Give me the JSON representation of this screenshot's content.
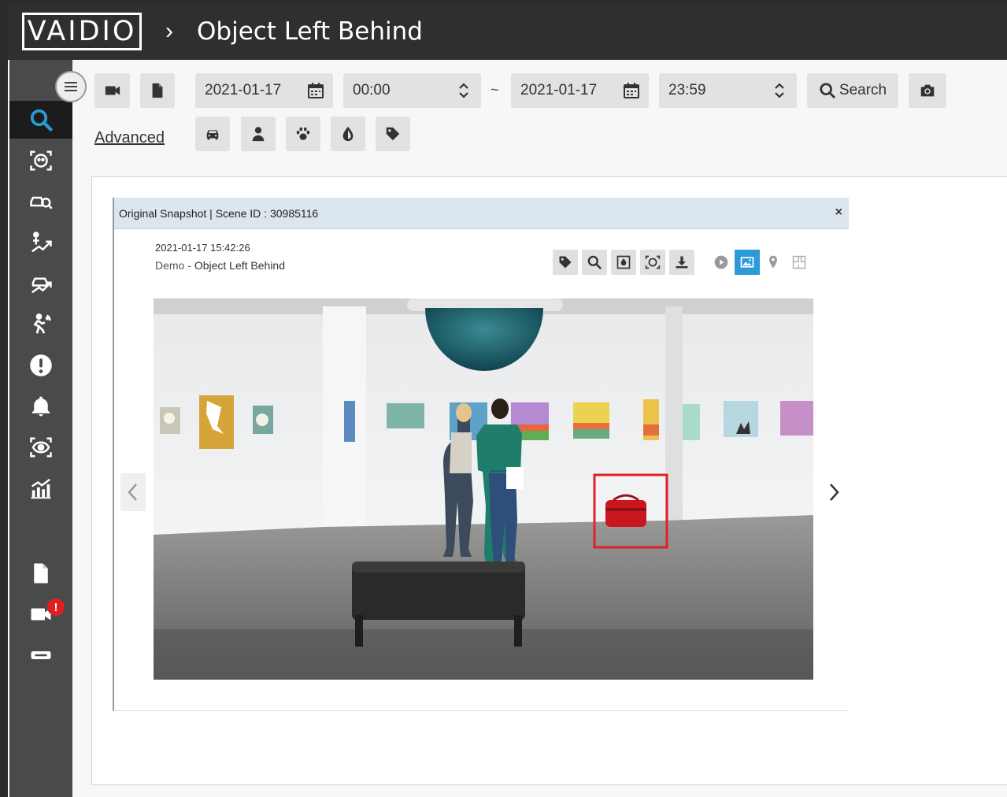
{
  "header": {
    "logo": "VAIDIO",
    "separator": "›",
    "title": "Object Left Behind"
  },
  "sidebar": {
    "items": [
      {
        "name": "search",
        "icon": "search-icon",
        "active": true
      },
      {
        "name": "face",
        "icon": "face-scan-icon"
      },
      {
        "name": "vehicle",
        "icon": "vehicle-search-icon"
      },
      {
        "name": "person-traffic",
        "icon": "person-trend-icon"
      },
      {
        "name": "vehicle-traffic",
        "icon": "vehicle-trend-icon"
      },
      {
        "name": "intrusion",
        "icon": "running-person-icon"
      },
      {
        "name": "alerts",
        "icon": "exclamation-icon"
      },
      {
        "name": "notifications",
        "icon": "bell-icon"
      },
      {
        "name": "monitor",
        "icon": "eye-scan-icon"
      },
      {
        "name": "reports",
        "icon": "analytics-chart-icon"
      },
      {
        "name": "files",
        "icon": "document-icon"
      },
      {
        "name": "cameras",
        "icon": "video-camera-icon",
        "badge": "!"
      },
      {
        "name": "devices",
        "icon": "device-icon"
      }
    ]
  },
  "search": {
    "start_date": "2021-01-17",
    "start_time": "00:00",
    "range_separator": "~",
    "end_date": "2021-01-17",
    "end_time": "23:59",
    "search_label": "Search",
    "advanced_label": "Advanced"
  },
  "snapshot": {
    "header": "Original Snapshot | Scene ID : 30985116",
    "close": "×",
    "timestamp": "2021-01-17 15:42:26",
    "camera": "Demo",
    "dash": " - ",
    "event": "Object Left Behind"
  },
  "colors": {
    "accent": "#2b9ad6",
    "alert": "#e02020",
    "bbox": "#e0202a"
  }
}
